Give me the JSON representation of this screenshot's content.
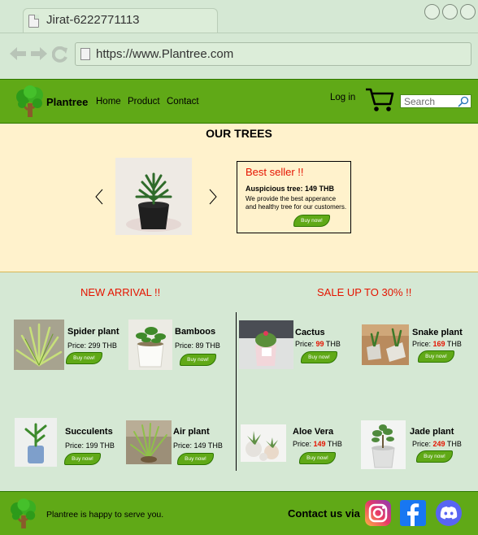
{
  "browser": {
    "tab_title": "Jirat-6222771113",
    "url": "https://www.Plantree.com"
  },
  "header": {
    "brand": "Plantree",
    "nav": [
      "Home",
      "Product",
      "Contact"
    ],
    "login": "Log in",
    "search_placeholder": "Search"
  },
  "hero": {
    "title": "OUR TREES",
    "best_seller": {
      "title": "Best seller !!",
      "name": "Auspicious tree: 149 THB",
      "description": "We provide the best apperance and healthy tree for our customers.",
      "button": "Buy now!"
    }
  },
  "new_arrival": {
    "title": "NEW ARRIVAL !!",
    "items": [
      {
        "name": "Spider plant",
        "price_label": "Price:",
        "price": "299",
        "currency": "THB",
        "button": "Buy now!"
      },
      {
        "name": "Bamboos",
        "price_label": "Price:",
        "price": "89",
        "currency": "THB",
        "button": "Buy now!"
      },
      {
        "name": "Succulents",
        "price_label": "Price:",
        "price": "199",
        "currency": "THB",
        "button": "Buy now!"
      },
      {
        "name": "Air plant",
        "price_label": "Price:",
        "price": "149",
        "currency": "THB",
        "button": "Buy now!"
      }
    ]
  },
  "sale": {
    "title": "SALE UP TO 30% !!",
    "items": [
      {
        "name": "Cactus",
        "price_label": "Price:",
        "price": "99",
        "currency": "THB",
        "button": "Buy now!"
      },
      {
        "name": "Snake plant",
        "price_label": "Price:",
        "price": "169",
        "currency": "THB",
        "button": "Buy now!"
      },
      {
        "name": "Aloe Vera",
        "price_label": "Price:",
        "price": "149",
        "currency": "THB",
        "button": "Buy now!"
      },
      {
        "name": "Jade plant",
        "price_label": "Price:",
        "price": "249",
        "currency": "THB",
        "button": "Buy now!"
      }
    ]
  },
  "footer": {
    "text": "Plantree is happy to serve you.",
    "contact": "Contact us via"
  },
  "colors": {
    "header_green": "#60a917",
    "hero_bg": "#fff2cc",
    "page_bg": "#d5e8d4",
    "accent_red": "#e51400"
  },
  "icons": [
    "tree-logo-icon",
    "cart-icon",
    "search-icon",
    "instagram-icon",
    "facebook-icon",
    "discord-icon"
  ]
}
